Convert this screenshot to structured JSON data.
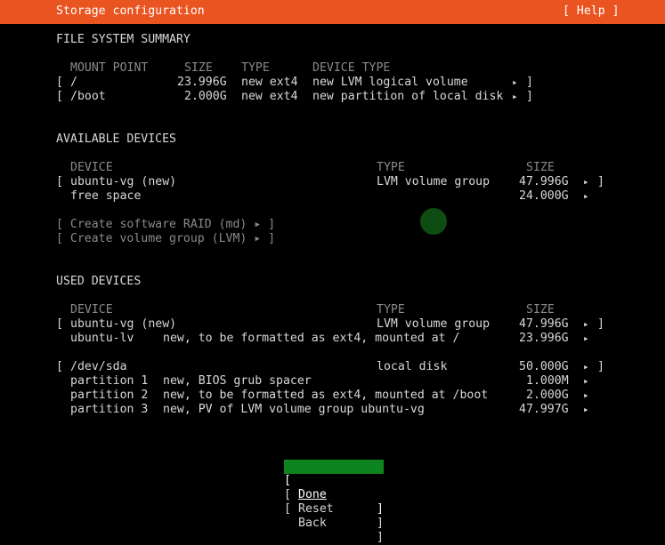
{
  "header": {
    "title": "Storage configuration",
    "help": "[ Help ]"
  },
  "fs_summary": {
    "heading": "FILE SYSTEM SUMMARY",
    "columns": [
      "MOUNT POINT",
      "SIZE",
      "TYPE",
      "DEVICE TYPE"
    ],
    "rows": [
      {
        "mount": "/",
        "size": "23.996G",
        "type": "new ext4",
        "device_type": "new LVM logical volume"
      },
      {
        "mount": "/boot",
        "size": "2.000G",
        "type": "new ext4",
        "device_type": "new partition of local disk"
      }
    ]
  },
  "available": {
    "heading": "AVAILABLE DEVICES",
    "columns": [
      "DEVICE",
      "TYPE",
      "SIZE"
    ],
    "rows": [
      {
        "device": "ubuntu-vg (new)",
        "type": "LVM volume group",
        "size": "47.996G"
      },
      {
        "device": "free space",
        "type": "",
        "size": "24.000G"
      }
    ],
    "actions": [
      "[ Create software RAID (md) ▸ ]",
      "[ Create volume group (LVM) ▸ ]"
    ]
  },
  "used": {
    "heading": "USED DEVICES",
    "columns": [
      "DEVICE",
      "TYPE",
      "SIZE"
    ],
    "groups": [
      {
        "device": "ubuntu-vg (new)",
        "type": "LVM volume group",
        "size": "47.996G",
        "children": [
          {
            "name": "ubuntu-lv",
            "desc": "new, to be formatted as ext4, mounted at /",
            "size": "23.996G"
          }
        ]
      },
      {
        "device": "/dev/sda",
        "type": "local disk",
        "size": "50.000G",
        "children": [
          {
            "name": "partition 1",
            "desc": "new, BIOS grub spacer",
            "size": "1.000M"
          },
          {
            "name": "partition 2",
            "desc": "new, to be formatted as ext4, mounted at /boot",
            "size": "2.000G"
          },
          {
            "name": "partition 3",
            "desc": "new, PV of LVM volume group ubuntu-vg",
            "size": "47.997G"
          }
        ]
      }
    ]
  },
  "buttons": {
    "done": "Done",
    "reset": "Reset",
    "back": "Back"
  },
  "glyphs": {
    "open": "[",
    "close": "]",
    "arrow": "▸"
  },
  "colors": {
    "header_bg": "#e95420",
    "focus_bg": "#0e8420",
    "background": "#000000"
  }
}
